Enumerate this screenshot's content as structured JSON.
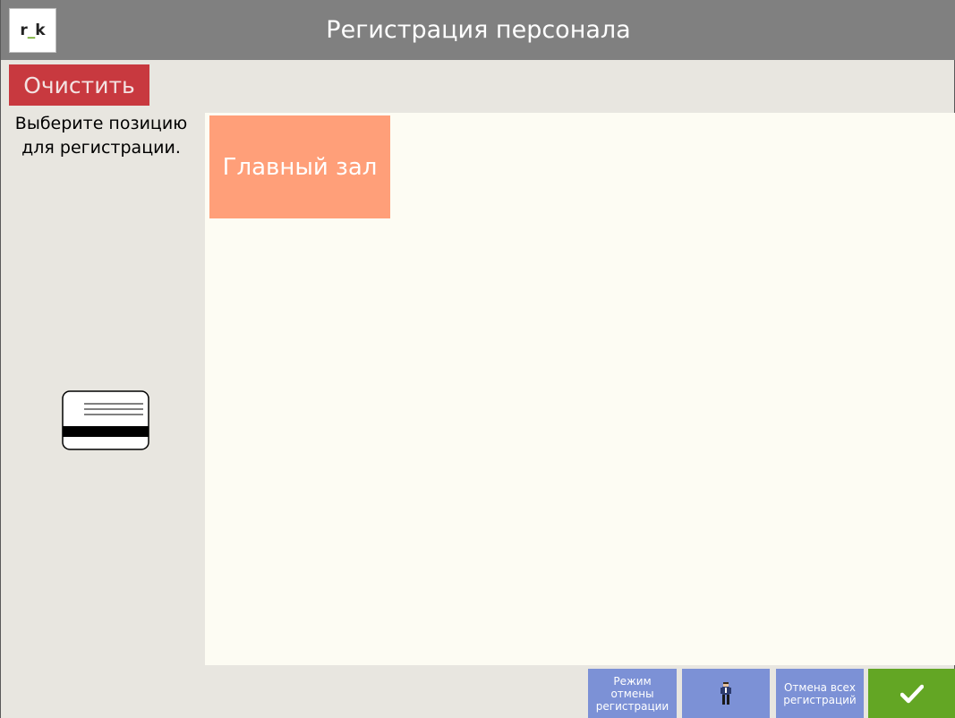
{
  "header": {
    "logo_text_left": "r",
    "logo_text_mid": "_",
    "logo_text_right": "k",
    "title": "Регистрация персонала"
  },
  "sidebar": {
    "clear_label": "Очистить",
    "instruction": "Выберите позицию для регистрации.",
    "card_icon": "magnetic-card-icon"
  },
  "main": {
    "positions": [
      {
        "label": "Главный зал"
      }
    ]
  },
  "footer": {
    "cancel_mode_label": "Режим отмены регистрации",
    "person_icon": "person-icon",
    "cancel_all_label": "Отмена всех регистраций",
    "confirm_icon": "checkmark-icon"
  },
  "colors": {
    "header_bg": "#808080",
    "clear_bg": "#c8393f",
    "position_bg": "#ff9f79",
    "footer_btn_bg": "#7c91d6",
    "confirm_bg": "#63a624",
    "content_bg": "#fdfcf3",
    "panel_bg": "#e8e6e0"
  }
}
